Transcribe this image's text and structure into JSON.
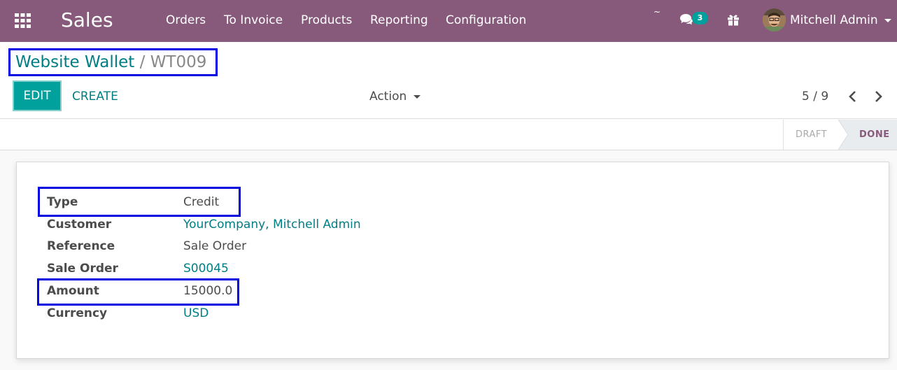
{
  "navbar": {
    "brand": "Sales",
    "menu": [
      "Orders",
      "To Invoice",
      "Products",
      "Reporting",
      "Configuration"
    ],
    "tilde": "~",
    "chat_count": "3",
    "user_name": "Mitchell Admin",
    "icons": [
      "apps-grid-icon",
      "chat-icon",
      "gift-icon"
    ]
  },
  "breadcrumb": {
    "parent": "Website Wallet",
    "separator": " / ",
    "current": "WT009"
  },
  "buttons": {
    "edit": "EDIT",
    "create": "CREATE",
    "action": "Action"
  },
  "pager": {
    "value": "5 / 9"
  },
  "status": {
    "stages": [
      "DRAFT",
      "DONE"
    ],
    "active": "DONE"
  },
  "form": {
    "fields": [
      {
        "label": "Type",
        "value": "Credit",
        "link": false
      },
      {
        "label": "Customer",
        "value": "YourCompany, Mitchell Admin",
        "link": true
      },
      {
        "label": "Reference",
        "value": "Sale Order",
        "link": false
      },
      {
        "label": "Sale Order",
        "value": "S00045",
        "link": true
      },
      {
        "label": "Amount",
        "value": "15000.0",
        "link": false
      },
      {
        "label": "Currency",
        "value": "USD",
        "link": true
      }
    ]
  },
  "colors": {
    "brand_purple": "#875a7b",
    "primary_teal": "#00a09d",
    "link_teal": "#017e84",
    "highlight_box": "#0000e0"
  }
}
